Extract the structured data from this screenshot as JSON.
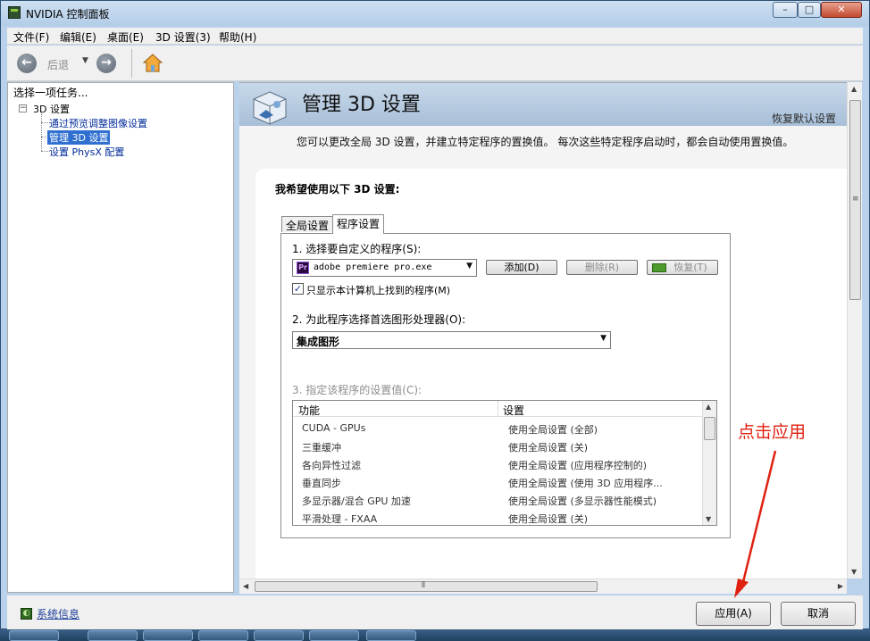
{
  "window": {
    "title": "NVIDIA 控制面板",
    "minimize": "–",
    "maximize": "□",
    "close": "✕"
  },
  "menu": [
    "文件(F)",
    "编辑(E)",
    "桌面(E)",
    "3D 设置(3)",
    "帮助(H)"
  ],
  "toolbar": {
    "back_label": "后退",
    "back_dropdown": "▼"
  },
  "sidebar": {
    "task_label": "选择一项任务...",
    "toggle": "−",
    "root": "3D 设置",
    "items": [
      {
        "label": "通过预览调整图像设置",
        "selected": false
      },
      {
        "label": "管理 3D 设置",
        "selected": true
      },
      {
        "label": "设置 PhysX 配置",
        "selected": false
      }
    ]
  },
  "page": {
    "title": "管理 3D 设置",
    "restore_defaults": "恢复默认设置",
    "description": "您可以更改全局 3D 设置，并建立特定程序的置换值。 每次这些特定程序启动时，都会自动使用置换值。",
    "wish_label": "我希望使用以下 3D 设置:"
  },
  "tabs": {
    "global": "全局设置",
    "program": "程序设置"
  },
  "program_tab": {
    "step1": "1. 选择要自定义的程序(S):",
    "app_icon_text": "Pr",
    "selected_app": "adobe premiere pro.exe",
    "add_button": "添加(D)",
    "remove_button": "删除(R)",
    "restore_button": "恢复(T)",
    "only_show_check": "✓",
    "only_show_label": "只显示本计算机上找到的程序(M)",
    "step2": "2. 为此程序选择首选图形处理器(O):",
    "gpu_selected": "集成图形",
    "step3": "3. 指定该程序的设置值(C):"
  },
  "settings_table": {
    "headers": [
      "功能",
      "设置"
    ],
    "rows": [
      {
        "feature": "CUDA - GPUs",
        "setting": "使用全局设置 (全部)"
      },
      {
        "feature": "三重缓冲",
        "setting": "使用全局设置 (关)"
      },
      {
        "feature": "各向异性过滤",
        "setting": "使用全局设置 (应用程序控制的)"
      },
      {
        "feature": "垂直同步",
        "setting": "使用全局设置 (使用 3D 应用程序..."
      },
      {
        "feature": "多显示器/混合 GPU 加速",
        "setting": "使用全局设置 (多显示器性能模式)"
      },
      {
        "feature": "平滑处理 - FXAA",
        "setting": "使用全局设置 (关)"
      }
    ]
  },
  "footer": {
    "sysinfo_icon": "◐",
    "sysinfo": "系统信息",
    "apply": "应用(A)",
    "cancel": "取消"
  },
  "annotation": {
    "text": "点击应用",
    "color": "#e02010"
  },
  "scroll": {
    "up": "▲",
    "down": "▼",
    "left": "◀",
    "right": "▶",
    "grip": "≡",
    "hgrip": "⦀"
  },
  "colors": {
    "selected_item": "#2f6fd0",
    "nvidia_green": "#76b900"
  }
}
